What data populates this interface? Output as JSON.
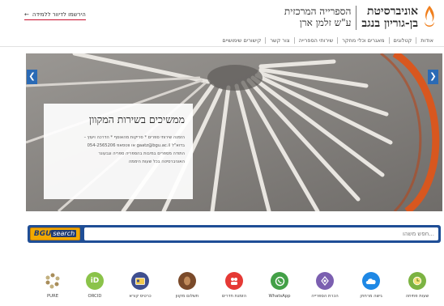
{
  "header": {
    "university_name_line1": "אוניברסיטת",
    "university_name_line2": "בן-גוריון בנגב",
    "library_name_line1": "הספרייה המרכזית",
    "library_name_line2": "ע\"ש זלמן ארן",
    "register_link": "הירשמו לדיוור ללמידה",
    "register_arrow": "←"
  },
  "nav": {
    "items": [
      {
        "label": "אודות"
      },
      {
        "label": "קטלוגים"
      },
      {
        "label": "מאגרים וכלי מחקר"
      },
      {
        "label": "שירותי הספרייה"
      },
      {
        "label": "צור קשר"
      },
      {
        "label": "קישורים שימושיים"
      }
    ]
  },
  "carousel": {
    "slide_title": "ממשיכים בשירות המקוון",
    "slide_lines": [
      "הזמנה שירותי ספרים * סריקות מהאוסף * הדרכה ויעוץ –",
      "בדוא\"ל gaatz@bgu.ac.il או ווטסאפ 054-2565206",
      "התודה מספרים במיבות בהספריה ספריה וגבעונר",
      "האוניברסיטה בכל שעות היממה"
    ],
    "prev_glyph": "❮",
    "next_glyph": "❯",
    "active_slide": 1,
    "slide_count": 2
  },
  "search": {
    "logo_text": "BGU",
    "logo_sub": "search",
    "placeholder": "...חפש משהו"
  },
  "quick_links": [
    {
      "label": "PURE",
      "icon": "pure-icon",
      "color": "#a88d5a"
    },
    {
      "label": "ORCID",
      "icon": "orcid-icon",
      "color": "#8bc34a"
    },
    {
      "label": "כרטיס קורא",
      "icon": "card-icon",
      "color": "#3f4f8f"
    },
    {
      "label": "תשלום מקוון",
      "icon": "payment-icon",
      "color": "#7a4a2a"
    },
    {
      "label": "הזמנת חדרים",
      "icon": "rooms-icon",
      "color": "#e53935"
    },
    {
      "label": "WhatsApp",
      "icon": "whatsapp-icon",
      "color": "#43a047"
    },
    {
      "label": "הכרת הספרייה",
      "icon": "tour-icon",
      "color": "#7b5fb0"
    },
    {
      "label": "גישה מרחוק",
      "icon": "cloud-icon",
      "color": "#1e88e5"
    },
    {
      "label": "שעות פתיחה",
      "icon": "clock-icon",
      "color": "#7cb342"
    }
  ]
}
